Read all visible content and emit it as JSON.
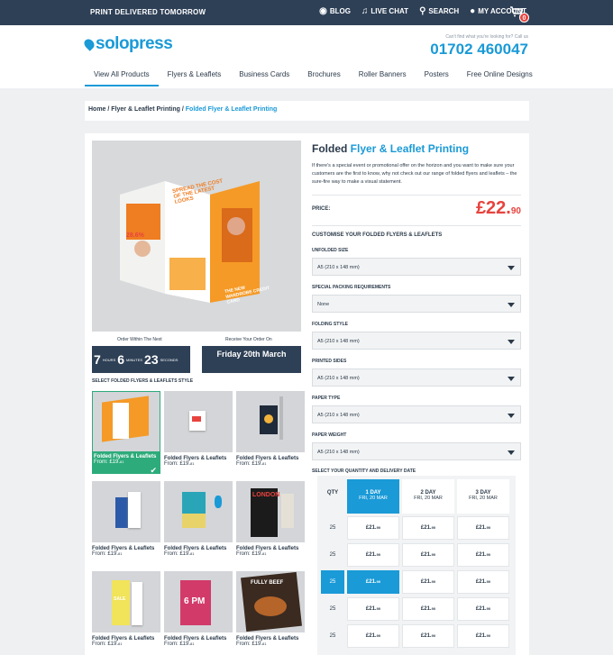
{
  "topbar": {
    "promo": "PRINT DELIVERED TOMORROW",
    "links": [
      {
        "label": "BLOG",
        "icon": "rss-icon"
      },
      {
        "label": "LIVE CHAT",
        "icon": "headset-icon"
      },
      {
        "label": "SEARCH",
        "icon": "search-icon"
      },
      {
        "label": "MY ACCOUNT",
        "icon": "user-icon"
      }
    ],
    "cart_count": "0"
  },
  "header": {
    "logo": "solopress",
    "help_text": "Can't find what you're looking for? Call us",
    "phone": "01702 460047"
  },
  "nav": [
    "View All Products",
    "Flyers & Leaflets",
    "Business Cards",
    "Brochures",
    "Roller Banners",
    "Posters",
    "Free Online Designs"
  ],
  "breadcrumb": {
    "home": "Home",
    "sep": " / ",
    "mid": "Flyer & Leaflet Printing",
    "current": "Folded Flyer & Leaflet Printing"
  },
  "hero": {
    "text_a": "SPREAD THE COST OF THE LATEST LOOKS",
    "text_b": "28.6%",
    "text_c": "THE NEW WARDROBE CREDIT CARD"
  },
  "countdown": {
    "label": "Order Within The Next",
    "hours": "7",
    "hours_unit": "HOURS",
    "minutes": "6",
    "minutes_unit": "MINUTES",
    "seconds": "23",
    "seconds_unit": "SECONDS",
    "deliver_label": "Receive Your Order On",
    "deliver_date": "Friday 20th March"
  },
  "styles": {
    "title": "SELECT FOLDED FLYERS & LEAFLETS STYLE",
    "cards": [
      {
        "title": "Folded Flyers & Leaflets",
        "price": "From: £19.",
        "pence": "81"
      },
      {
        "title": "Folded Flyers & Leaflets",
        "price": "From: £19.",
        "pence": "81"
      },
      {
        "title": "Folded Flyers & Leaflets",
        "price": "From: £19.",
        "pence": "81"
      },
      {
        "title": "Folded Flyers & Leaflets",
        "price": "From: £19.",
        "pence": "81"
      },
      {
        "title": "Folded Flyers & Leaflets",
        "price": "From: £19.",
        "pence": "81"
      },
      {
        "title": "Folded Flyers & Leaflets",
        "price": "From: £19.",
        "pence": "81"
      },
      {
        "title": "Folded Flyers & Leaflets",
        "price": "From: £19.",
        "pence": "81"
      },
      {
        "title": "Folded Flyers & Leaflets",
        "price": "From: £19.",
        "pence": "81"
      },
      {
        "title": "Folded Flyers & Leaflets",
        "price": "From: £19.",
        "pence": "81"
      }
    ],
    "card_texts": {
      "c3": "LONDON",
      "c6": "6 PM",
      "c6b": "SALE",
      "c7": "FULLY BEEF"
    }
  },
  "product": {
    "title_a": "Folded ",
    "title_b": "Flyer & Leaflet Printing",
    "description": "If there's a special event or promotional offer on the horizon and you want to make sure your customers are the first to know, why not check out our range of folded flyers and leaflets – the sure-fire way to make a visual statement.",
    "price_label": "PRICE:",
    "price_pounds": "£22.",
    "price_pence": "90",
    "customise": "CUSTOMISE YOUR FOLDED FLYERS & LEAFLETS",
    "options": [
      {
        "label": "UNFOLDED SIZE",
        "value": "A5 (210 x 148 mm)"
      },
      {
        "label": "SPECIAL PACKING REQUIREMENTS",
        "value": "None"
      },
      {
        "label": "FOLDING STYLE",
        "value": "A5 (210 x 148 mm)"
      },
      {
        "label": "PRINTED SIDES",
        "value": "A5 (210 x 148 mm)"
      },
      {
        "label": "PAPER TYPE",
        "value": "A5 (210 x 148 mm)"
      },
      {
        "label": "PAPER WEIGHT",
        "value": "A5 (210 x 148 mm)"
      }
    ]
  },
  "quantity": {
    "title": "SELECT YOUR QUANTITY AND DELIVERY DATE",
    "qty_header": "QTY",
    "columns": [
      {
        "day": "1 DAY",
        "date": "FRI, 20 MAR"
      },
      {
        "day": "2 DAY",
        "date": "FRI, 20 MAR"
      },
      {
        "day": "3 DAY",
        "date": "FRI, 20 MAR"
      }
    ],
    "rows": [
      {
        "qty": "25",
        "price": "£21.",
        "pence": "90"
      },
      {
        "qty": "25",
        "price": "£21.",
        "pence": "90"
      },
      {
        "qty": "25",
        "price": "£21.",
        "pence": "90"
      },
      {
        "qty": "25",
        "price": "£21.",
        "pence": "90"
      },
      {
        "qty": "25",
        "price": "£21.",
        "pence": "90"
      }
    ],
    "selected_row": 2,
    "selected_col": 0
  },
  "colors": {
    "brand_blue": "#1a9ad7",
    "navy": "#2e4056",
    "price_red": "#e8433e",
    "selected_green": "#2dab7b"
  }
}
